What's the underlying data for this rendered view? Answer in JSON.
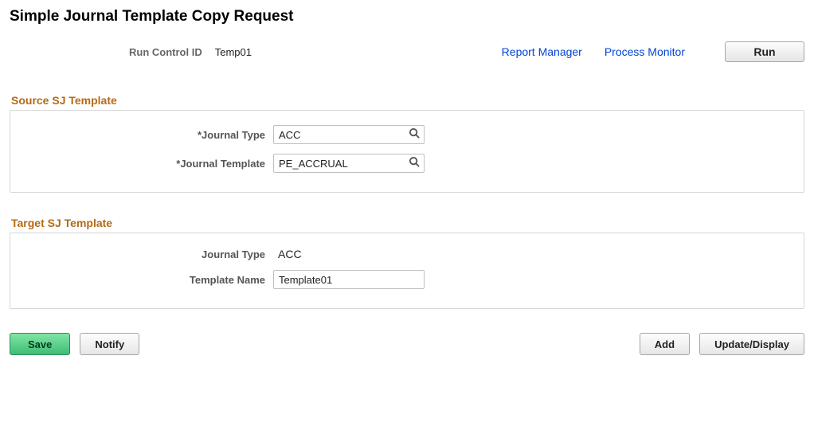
{
  "page": {
    "title": "Simple Journal Template Copy Request"
  },
  "run_control": {
    "label": "Run Control ID",
    "value": "Temp01"
  },
  "top_links": {
    "report_manager": "Report Manager",
    "process_monitor": "Process Monitor"
  },
  "buttons": {
    "run": "Run",
    "save": "Save",
    "notify": "Notify",
    "add": "Add",
    "update_display": "Update/Display"
  },
  "sections": {
    "source": {
      "title": "Source SJ Template",
      "journal_type_label": "*Journal Type",
      "journal_type_value": "ACC",
      "journal_template_label": "*Journal Template",
      "journal_template_value": "PE_ACCRUAL"
    },
    "target": {
      "title": "Target SJ Template",
      "journal_type_label": "Journal Type",
      "journal_type_value": "ACC",
      "template_name_label": "Template Name",
      "template_name_value": "Template01"
    }
  }
}
